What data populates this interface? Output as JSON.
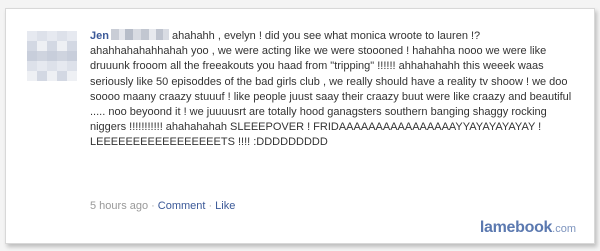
{
  "post": {
    "author_first": "Jen",
    "text": "ahahahh , evelyn ! did you see what monica wroote to lauren !? ahahhahahahhahah yoo , we were acting like we were stoooned ! hahahha nooo we were like druuunk frooom all the freeakouts you haad from \"tripping\" !!!!!! ahhahahahh this weeek waas seriously like 50 episoddes of the bad girls club , we really should have a reality tv shoow ! we doo soooo maany craazy stuuuf ! like people juust saay their craazy buut were like craazy and beautiful ..... noo beyoond it ! we juuuusrt are totally hood ganagsters southern banging shaggy rocking niggers !!!!!!!!!!! ahahahahah SLEEEPOVER ! FRIDAAAAAAAAAAAAAAAAYYAYAYAYAYAY ! LEEEEEEEEEEEEEEEEETS !!!! :DDDDDDDDD"
  },
  "meta": {
    "time": "5 hours ago",
    "separator": "·",
    "comment_label": "Comment",
    "like_label": "Like"
  },
  "brand": {
    "name": "lamebook",
    "tld": ".com"
  },
  "colors": {
    "link": "#3b5998",
    "meta_text": "#999999",
    "brand": "#5b79b0"
  },
  "icons": {
    "avatar": "blurred-profile-picture",
    "surname": "pixelated-redaction"
  }
}
